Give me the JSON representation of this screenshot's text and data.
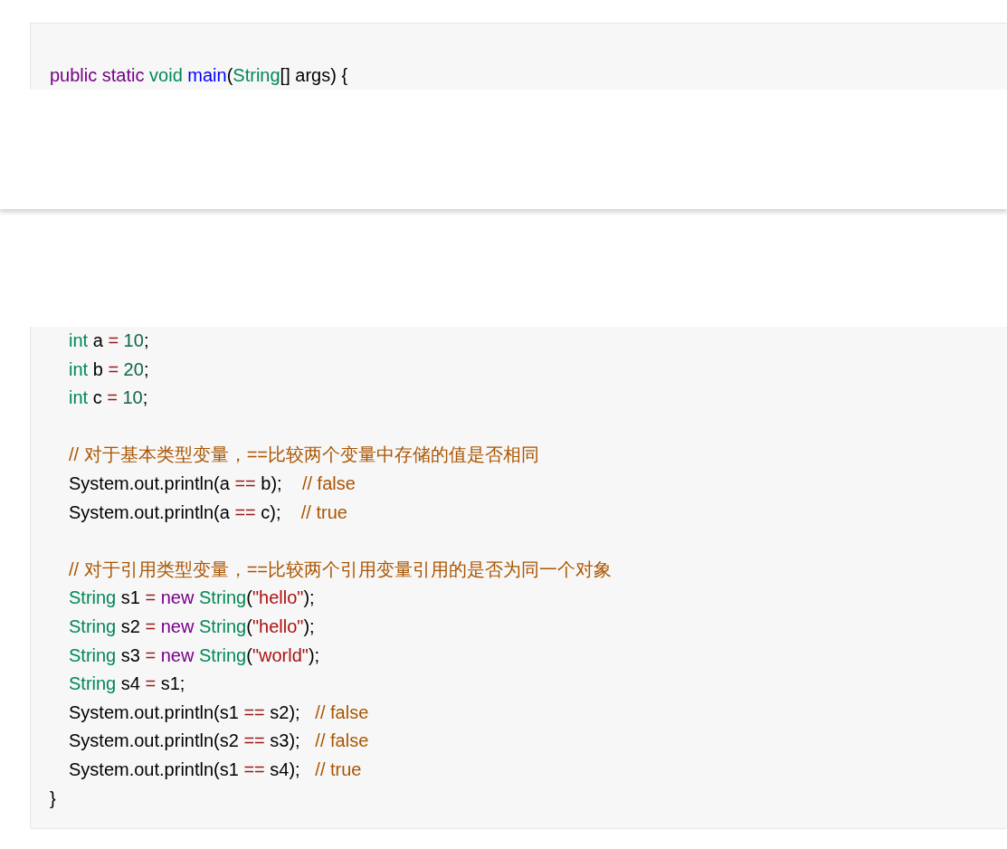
{
  "code_block_top": {
    "lines": [
      {
        "kind": "flush",
        "tokens": [
          {
            "text": "public static ",
            "kind": "keyword"
          },
          {
            "text": "void ",
            "kind": "type"
          },
          {
            "text": "main",
            "kind": "func"
          },
          {
            "text": "(",
            "kind": "plain"
          },
          {
            "text": "String",
            "kind": "type"
          },
          {
            "text": "[] args) {",
            "kind": "plain"
          }
        ]
      }
    ]
  },
  "code_block_bottom": {
    "lines": [
      {
        "kind": "indented",
        "tokens": [
          {
            "text": "int ",
            "kind": "type"
          },
          {
            "text": "a ",
            "kind": "plain"
          },
          {
            "text": "=",
            "kind": "op"
          },
          {
            "text": " 10",
            "kind": "num"
          },
          {
            "text": ";",
            "kind": "plain"
          }
        ]
      },
      {
        "kind": "indented",
        "tokens": [
          {
            "text": "int ",
            "kind": "type"
          },
          {
            "text": "b ",
            "kind": "plain"
          },
          {
            "text": "=",
            "kind": "op"
          },
          {
            "text": " 20",
            "kind": "num"
          },
          {
            "text": ";",
            "kind": "plain"
          }
        ]
      },
      {
        "kind": "indented",
        "tokens": [
          {
            "text": "int ",
            "kind": "type"
          },
          {
            "text": "c ",
            "kind": "plain"
          },
          {
            "text": "=",
            "kind": "op"
          },
          {
            "text": " 10",
            "kind": "num"
          },
          {
            "text": ";",
            "kind": "plain"
          }
        ]
      },
      {
        "kind": "blank"
      },
      {
        "kind": "indented",
        "tokens": [
          {
            "text": "// 对于基本类型变量，==比较两个变量中存储的值是否相同",
            "kind": "comment"
          }
        ]
      },
      {
        "kind": "indented",
        "tokens": [
          {
            "text": "System.out.println(a ",
            "kind": "plain"
          },
          {
            "text": "==",
            "kind": "op"
          },
          {
            "text": " b);    ",
            "kind": "plain"
          },
          {
            "text": "// false",
            "kind": "comment"
          }
        ]
      },
      {
        "kind": "indented",
        "tokens": [
          {
            "text": "System.out.println(a ",
            "kind": "plain"
          },
          {
            "text": "==",
            "kind": "op"
          },
          {
            "text": " c);    ",
            "kind": "plain"
          },
          {
            "text": "// true",
            "kind": "comment"
          }
        ]
      },
      {
        "kind": "blank"
      },
      {
        "kind": "indented",
        "tokens": [
          {
            "text": "// 对于引用类型变量，==比较两个引用变量引用的是否为同一个对象",
            "kind": "comment"
          }
        ]
      },
      {
        "kind": "indented",
        "tokens": [
          {
            "text": "String ",
            "kind": "type"
          },
          {
            "text": "s1 ",
            "kind": "plain"
          },
          {
            "text": "= ",
            "kind": "op"
          },
          {
            "text": "new ",
            "kind": "keyword"
          },
          {
            "text": "String",
            "kind": "type"
          },
          {
            "text": "(",
            "kind": "plain"
          },
          {
            "text": "\"hello\"",
            "kind": "str"
          },
          {
            "text": ");",
            "kind": "plain"
          }
        ]
      },
      {
        "kind": "indented",
        "tokens": [
          {
            "text": "String ",
            "kind": "type"
          },
          {
            "text": "s2 ",
            "kind": "plain"
          },
          {
            "text": "= ",
            "kind": "op"
          },
          {
            "text": "new ",
            "kind": "keyword"
          },
          {
            "text": "String",
            "kind": "type"
          },
          {
            "text": "(",
            "kind": "plain"
          },
          {
            "text": "\"hello\"",
            "kind": "str"
          },
          {
            "text": ");",
            "kind": "plain"
          }
        ]
      },
      {
        "kind": "indented",
        "tokens": [
          {
            "text": "String ",
            "kind": "type"
          },
          {
            "text": "s3 ",
            "kind": "plain"
          },
          {
            "text": "= ",
            "kind": "op"
          },
          {
            "text": "new ",
            "kind": "keyword"
          },
          {
            "text": "String",
            "kind": "type"
          },
          {
            "text": "(",
            "kind": "plain"
          },
          {
            "text": "\"world\"",
            "kind": "str"
          },
          {
            "text": ");",
            "kind": "plain"
          }
        ]
      },
      {
        "kind": "indented",
        "tokens": [
          {
            "text": "String ",
            "kind": "type"
          },
          {
            "text": "s4 ",
            "kind": "plain"
          },
          {
            "text": "=",
            "kind": "op"
          },
          {
            "text": " s1;",
            "kind": "plain"
          }
        ]
      },
      {
        "kind": "indented",
        "tokens": [
          {
            "text": "System.out.println(s1 ",
            "kind": "plain"
          },
          {
            "text": "==",
            "kind": "op"
          },
          {
            "text": " s2);   ",
            "kind": "plain"
          },
          {
            "text": "// false",
            "kind": "comment"
          }
        ]
      },
      {
        "kind": "indented",
        "tokens": [
          {
            "text": "System.out.println(s2 ",
            "kind": "plain"
          },
          {
            "text": "==",
            "kind": "op"
          },
          {
            "text": " s3);   ",
            "kind": "plain"
          },
          {
            "text": "// false",
            "kind": "comment"
          }
        ]
      },
      {
        "kind": "indented",
        "tokens": [
          {
            "text": "System.out.println(s1 ",
            "kind": "plain"
          },
          {
            "text": "==",
            "kind": "op"
          },
          {
            "text": " s4);   ",
            "kind": "plain"
          },
          {
            "text": "// true",
            "kind": "comment"
          }
        ]
      },
      {
        "kind": "flush",
        "tokens": [
          {
            "text": "}",
            "kind": "plain"
          }
        ]
      }
    ]
  }
}
